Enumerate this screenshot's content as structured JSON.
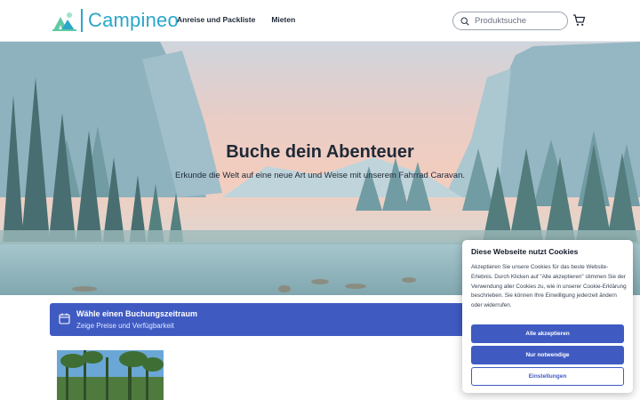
{
  "colors": {
    "brand": "#2aa7c9",
    "primary": "#3f5bc2",
    "text": "#1f2937"
  },
  "header": {
    "logo_text": "Campineo",
    "nav": [
      "Anreise und Packliste",
      "Mieten"
    ],
    "search_placeholder": "Produktsuche",
    "icons": [
      "logo-tents-icon",
      "search-icon",
      "cart-icon"
    ]
  },
  "hero": {
    "title": "Buche dein Abenteuer",
    "subtitle": "Erkunde die Welt auf eine neue Art und Weise mit unserem Fahrrad Caravan."
  },
  "booking": {
    "title": "Wähle einen Buchungszeitraum",
    "subtitle": "Zeige Preise und Verfügbarkeit",
    "icon": "calendar-icon"
  },
  "cookie": {
    "title": "Diese Webseite nutzt Cookies",
    "text": "Akzeptieren Sie unsere Cookies für das beste Website-Erlebnis. Durch Klicken auf \"Alle akzeptieren\" stimmen Sie der Verwendung aller Cookies zu, wie in unserer Cookie-Erklärung beschrieben. Sie können Ihre Einwilligung jederzeit ändern oder widerrufen.",
    "accept_all": "Alle akzeptieren",
    "necessary_only": "Nur notwendige",
    "settings": "Einstellungen"
  }
}
